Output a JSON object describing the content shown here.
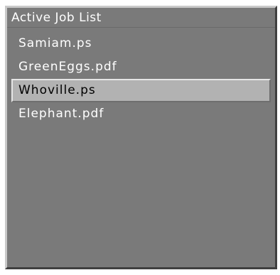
{
  "panel": {
    "title": "Active Job List"
  },
  "jobs": [
    {
      "name": "Samiam.ps",
      "selected": false
    },
    {
      "name": "GreenEggs.pdf",
      "selected": false
    },
    {
      "name": "Whoville.ps",
      "selected": true
    },
    {
      "name": "Elephant.pdf",
      "selected": false
    }
  ],
  "colors": {
    "panel_bg": "#7a7a7a",
    "selection_bg": "#b2b2b2",
    "text": "#ffffff",
    "selected_text": "#000000"
  }
}
